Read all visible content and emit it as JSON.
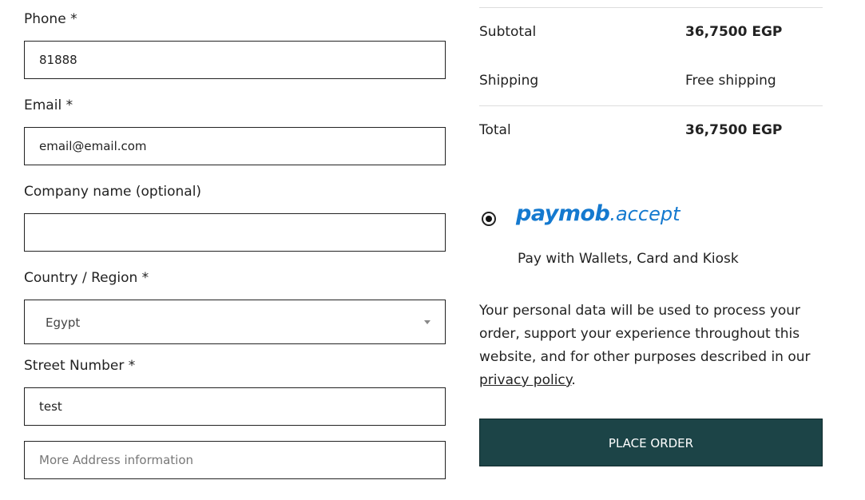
{
  "form": {
    "phone": {
      "label": "Phone *",
      "value": "81888"
    },
    "email": {
      "label": "Email *",
      "value": "email@email.com"
    },
    "company": {
      "label": "Company name (optional)",
      "value": ""
    },
    "country": {
      "label": "Country / Region *",
      "value": "Egypt"
    },
    "street": {
      "label": "Street Number *",
      "value": "test"
    },
    "address2": {
      "placeholder": "More Address information",
      "value": ""
    }
  },
  "summary": {
    "subtotal_label": "Subtotal",
    "subtotal_value": "36,7500 EGP",
    "shipping_label": "Shipping",
    "shipping_value": "Free shipping",
    "total_label": "Total",
    "total_value": "36,7500 EGP"
  },
  "payment": {
    "logo_brand": "paymob",
    "logo_suffix": "accept",
    "description": "Pay with Wallets, Card and Kiosk",
    "selected": true,
    "brand_color": "#1479cf"
  },
  "privacy": {
    "text": "Your personal data will be used to process your order, support your experience throughout this website, and for other purposes described in our ",
    "link": "privacy policy",
    "end": "."
  },
  "actions": {
    "place_order": "PLACE ORDER",
    "button_color": "#1c4447"
  }
}
